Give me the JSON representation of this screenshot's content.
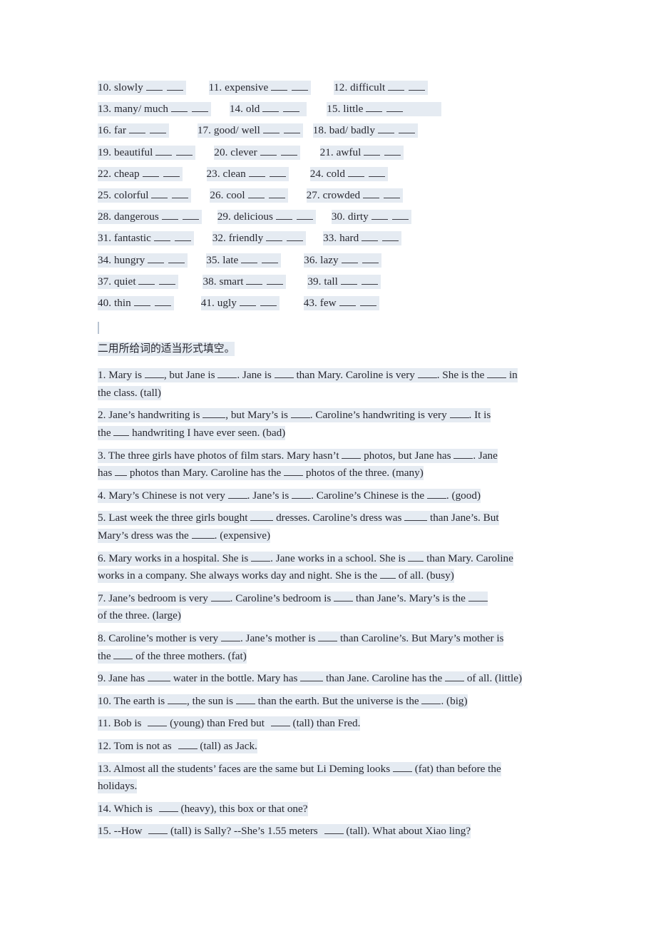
{
  "document": {
    "title": "English Comparative and Superlative Worksheet",
    "highlight_color": "#e5ebf2",
    "text_color": "#282830",
    "background_color": "#ffffff"
  },
  "section_one": {
    "rows": [
      {
        "items": [
          {
            "number": "10.",
            "word": "slowly"
          },
          {
            "number": "11.",
            "word": "expensive"
          },
          {
            "number": "12.",
            "word": "difficult"
          }
        ]
      },
      {
        "items": [
          {
            "number": "13.",
            "word": "many/ much"
          },
          {
            "number": "14.",
            "word": "old"
          },
          {
            "number": "15.",
            "word": "little"
          }
        ]
      },
      {
        "items": [
          {
            "number": "16.",
            "word": "far"
          },
          {
            "number": "17.",
            "word": "good/ well"
          },
          {
            "number": "18.",
            "word": "bad/ badly"
          }
        ]
      },
      {
        "items": [
          {
            "number": "19.",
            "word": "beautiful"
          },
          {
            "number": "20.",
            "word": "clever"
          },
          {
            "number": "21.",
            "word": "awful"
          }
        ]
      },
      {
        "items": [
          {
            "number": "22.",
            "word": "cheap"
          },
          {
            "number": "23.",
            "word": "clean"
          },
          {
            "number": "24.",
            "word": "cold"
          }
        ]
      },
      {
        "items": [
          {
            "number": "25.",
            "word": "colorful"
          },
          {
            "number": "26.",
            "word": "cool"
          },
          {
            "number": "27.",
            "word": "crowded"
          }
        ]
      },
      {
        "items": [
          {
            "number": "28.",
            "word": "dangerous"
          },
          {
            "number": "29.",
            "word": "delicious"
          },
          {
            "number": "30.",
            "word": "dirty"
          }
        ]
      },
      {
        "items": [
          {
            "number": "31.",
            "word": "fantastic"
          },
          {
            "number": "32.",
            "word": "friendly"
          },
          {
            "number": "33.",
            "word": "hard"
          }
        ]
      },
      {
        "items": [
          {
            "number": "34.",
            "word": "hungry"
          },
          {
            "number": "35.",
            "word": "late"
          },
          {
            "number": "36.",
            "word": "lazy"
          }
        ]
      },
      {
        "items": [
          {
            "number": "37.",
            "word": "quiet"
          },
          {
            "number": "38.",
            "word": "smart"
          },
          {
            "number": "39.",
            "word": "tall"
          }
        ]
      },
      {
        "items": [
          {
            "number": "40.",
            "word": "thin"
          },
          {
            "number": "41.",
            "word": "ugly"
          },
          {
            "number": "43.",
            "word": "few"
          }
        ]
      }
    ]
  },
  "section_two": {
    "heading": "二用所给词的适当形式填空。",
    "questions": [
      {
        "number": "1.",
        "line1_a": "Mary is ",
        "line1_b": ", but Jane is ",
        "line1_c": ". Jane is ",
        "line1_d": " than Mary. Caroline is very ",
        "line1_e": ". She is the ",
        "line1_f": " in",
        "line2": "the class. (tall)",
        "hint": "(tall)"
      },
      {
        "number": "2.",
        "line1_a": "Jane’s handwriting is ",
        "line1_b": ", but Mary’s is ",
        "line1_c": ". Caroline’s handwriting is very ",
        "line1_d": ". It is",
        "line2_a": "the ",
        "line2_b": " handwriting I have ever seen. (bad)",
        "hint": "(bad)"
      },
      {
        "number": "3.",
        "line1_a": "The three girls have photos of film stars. Mary hasn’t ",
        "line1_b": " photos, but Jane has ",
        "line1_c": ". Jane",
        "line2_a": "has ",
        "line2_b": " photos than Mary. Caroline has the ",
        "line2_c": " photos of the three. (many)",
        "hint": "(many)"
      },
      {
        "number": "4.",
        "line1_a": "Mary’s Chinese is not very ",
        "line1_b": ". Jane’s is ",
        "line1_c": ". Caroline’s Chinese is the ",
        "line1_d": ". (good)",
        "hint": "(good)"
      },
      {
        "number": "5.",
        "line1_a": "Last week the three girls bought ",
        "line1_b": " dresses. Caroline’s dress was ",
        "line1_c": " than Jane’s. But",
        "line2_a": "Mary’s dress was the ",
        "line2_b": ". (expensive)",
        "hint": "(expensive)"
      },
      {
        "number": "6.",
        "line1_a": "Mary works in a hospital. She is ",
        "line1_b": ". Jane works in a school. She is ",
        "line1_c": " than Mary. Caroline",
        "line2_a": "works in a company. She always works day and night. She is the ",
        "line2_b": " of all. (busy)",
        "hint": "(busy)"
      },
      {
        "number": "7.",
        "line1_a": "Jane’s bedroom is very ",
        "line1_b": ". Caroline’s bedroom is ",
        "line1_c": " than Jane’s. Mary’s is the ",
        "line2": " of the three. (large)",
        "hint": "(large)"
      },
      {
        "number": "8.",
        "line1_a": "Caroline’s mother is very ",
        "line1_b": ". Jane’s mother is ",
        "line1_c": " than Caroline’s. But Mary’s mother is",
        "line2_a": "the ",
        "line2_b": " of the three mothers. (fat)",
        "hint": "(fat)"
      },
      {
        "number": "9.",
        "line1_a": "Jane has ",
        "line1_b": " water in the bottle. Mary has ",
        "line1_c": " than Jane. Caroline has the ",
        "line1_d": " of all. (little)",
        "hint": "(little)"
      },
      {
        "number": "10.",
        "line1_a": "The earth is ",
        "line1_b": ", the sun is ",
        "line1_c": " than the earth. But the universe is the ",
        "line1_d": ". (big)",
        "hint": "(big)"
      },
      {
        "number": "11.",
        "line1_a": "Bob is ",
        "line1_b": " (young) than Fred but ",
        "line1_c": " (tall) than Fred.",
        "hint": "(young) (tall)"
      },
      {
        "number": "12.",
        "line1_a": "Tom is not as ",
        "line1_b": " (tall) as Jack.",
        "hint": "(tall)"
      },
      {
        "number": "13.",
        "line1_a": "Almost all the students’ faces are the same but Li Deming looks ",
        "line1_b": " (fat) than before the",
        "line2": "holidays.",
        "hint": "(fat)"
      },
      {
        "number": "14.",
        "line1_a": "Which is ",
        "line1_b": " (heavy), this box or that one?",
        "hint": "(heavy)"
      },
      {
        "number": "15.",
        "line1_a": "--How ",
        "line1_b": " (tall) is Sally?   --She’s 1.55 meters ",
        "line1_c": " (tall). What about Xiao ling?",
        "hint": "(tall)"
      }
    ]
  }
}
